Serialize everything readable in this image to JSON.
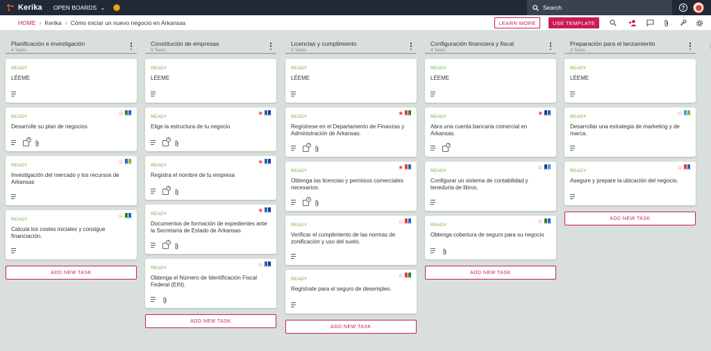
{
  "app": {
    "name": "Kerika",
    "open_boards_label": "OPEN BOARDS",
    "search_placeholder": "Search",
    "help_label": "?"
  },
  "breadcrumb": {
    "home": "HOME",
    "org": "Kerika",
    "board": "Cómo iniciar un nuevo negocio en Arkansas"
  },
  "actions": {
    "learn_more": "LEARN MORE",
    "use_template": "USE TEMPLATE"
  },
  "toolbar_icons": [
    "search-icon",
    "add-person-icon",
    "chat-icon",
    "attachment-icon",
    "wrench-icon",
    "settings-icon"
  ],
  "colors": {
    "accent": "#c91b56",
    "topbar": "#212936",
    "ready": "#6bad34",
    "star": "#e23b3b",
    "flag_blue": "#1f63c4",
    "flag_dark_blue": "#1f3c88",
    "flag_green": "#2e7d32",
    "flag_light_blue": "#3ba0e0",
    "flag_lime": "#7cb342",
    "flag_red": "#e53935"
  },
  "add_task_label": "ADD NEW TASK",
  "columns": [
    {
      "title": "Planificación e investigación",
      "count": "4 Tasks",
      "cards": [
        {
          "status": "READY",
          "title": "LÉEME",
          "star": "",
          "flags": [],
          "icons": [
            "details"
          ]
        },
        {
          "status": "READY",
          "title": "Desarrolle su plan de negocios",
          "star": "outline",
          "flags": [
            "green",
            "blue"
          ],
          "icons": [
            "details",
            "subtasks",
            "attachment"
          ],
          "subtask_count": "4"
        },
        {
          "status": "READY",
          "title": "Investigación del mercado y los recursos de Arkansas",
          "star": "outline",
          "flags": [
            "blue",
            "lime"
          ],
          "icons": [
            "details"
          ]
        },
        {
          "status": "READY",
          "title": "Calcula los costes iniciales y consigue financiación.",
          "star": "outline",
          "flags": [
            "green",
            "blue"
          ],
          "icons": [
            "details"
          ]
        }
      ]
    },
    {
      "title": "Constitución de empresas",
      "count": "5 Tasks",
      "cards": [
        {
          "status": "READY",
          "title": "LÉEME",
          "star": "",
          "flags": [],
          "icons": [
            "details"
          ]
        },
        {
          "status": "READY",
          "title": "Elige la estructura de tu negocio",
          "star": "filled",
          "flags": [
            "blue",
            "darkblue"
          ],
          "icons": [
            "details",
            "subtasks",
            "attachment"
          ],
          "subtask_count": "3"
        },
        {
          "status": "READY",
          "title": "Registra el nombre de tu empresa",
          "star": "filled",
          "flags": [
            "blue",
            "darkblue"
          ],
          "icons": [
            "details",
            "subtasks",
            "attachment"
          ],
          "subtask_count": "3"
        },
        {
          "status": "READY",
          "title": "Documentos de formación de expedientes ante la Secretaría de Estado de Arkansas",
          "star": "filled",
          "flags": [
            "blue",
            "darkblue"
          ],
          "icons": [
            "details",
            "subtasks",
            "attachment"
          ],
          "subtask_count": "3"
        },
        {
          "status": "READY",
          "title": "Obtenga el Número de Identificación Fiscal Federal (EIN).",
          "star": "outline",
          "flags": [
            "blue",
            "darkblue"
          ],
          "icons": [
            "details",
            "attachment"
          ]
        }
      ]
    },
    {
      "title": "Licencias y cumplimiento",
      "count": "5 Tasks",
      "cards": [
        {
          "status": "READY",
          "title": "LÉEME",
          "star": "",
          "flags": [],
          "icons": [
            "details"
          ]
        },
        {
          "status": "READY",
          "title": "Regístrese en el Departamento de Finanzas y Administración de Arkansas.",
          "star": "filled",
          "flags": [
            "red",
            "green"
          ],
          "icons": [
            "details",
            "subtasks",
            "attachment"
          ],
          "subtask_count": "3"
        },
        {
          "status": "READY",
          "title": "Obtenga las licencias y permisos comerciales necesarios.",
          "star": "filled",
          "flags": [
            "red",
            "blue"
          ],
          "icons": [
            "details",
            "subtasks",
            "attachment"
          ],
          "subtask_count": "3"
        },
        {
          "status": "READY",
          "title": "Verificar el cumplimiento de las normas de zonificación y uso del suelo.",
          "star": "outline",
          "flags": [
            "red",
            "blue"
          ],
          "icons": [
            "details"
          ]
        },
        {
          "status": "READY",
          "title": "Regístrate para el seguro de desempleo.",
          "star": "outline",
          "flags": [
            "red",
            "green"
          ],
          "icons": [
            "details"
          ]
        }
      ]
    },
    {
      "title": "Configuración financiera y fiscal",
      "count": "4 Tasks",
      "cards": [
        {
          "status": "READY",
          "title": "LÉEME",
          "star": "",
          "flags": [],
          "icons": [
            "details"
          ]
        },
        {
          "status": "READY",
          "title": "Abra una cuenta bancaria comercial en Arkansas.",
          "star": "filled",
          "flags": [
            "darkblue",
            "blue"
          ],
          "icons": [
            "details",
            "subtasks"
          ],
          "subtask_count": "3"
        },
        {
          "status": "READY",
          "title": "Configurar un sistema de contabilidad y teneduría de libros.",
          "star": "outline",
          "flags": [
            "darkblue",
            "lightblue"
          ],
          "icons": [
            "details"
          ]
        },
        {
          "status": "READY",
          "title": "Obtenga cobertura de seguro para su negocio",
          "star": "outline",
          "flags": [
            "green",
            "blue"
          ],
          "icons": [
            "details",
            "attachment"
          ]
        }
      ]
    },
    {
      "title": "Preparación para el lanzamiento",
      "count": "3 Tasks",
      "cards": [
        {
          "status": "READY",
          "title": "LÉEME",
          "star": "",
          "flags": [],
          "icons": [
            "details"
          ]
        },
        {
          "status": "READY",
          "title": "Desarrollar una estrategia de marketing y de marca.",
          "star": "outline",
          "flags": [
            "lightblue",
            "lime"
          ],
          "icons": [
            "details"
          ]
        },
        {
          "status": "READY",
          "title": "Asegure y prepare la ubicación del negocio.",
          "star": "outline",
          "flags": [
            "red",
            "blue"
          ],
          "icons": [
            "details"
          ]
        }
      ]
    }
  ]
}
